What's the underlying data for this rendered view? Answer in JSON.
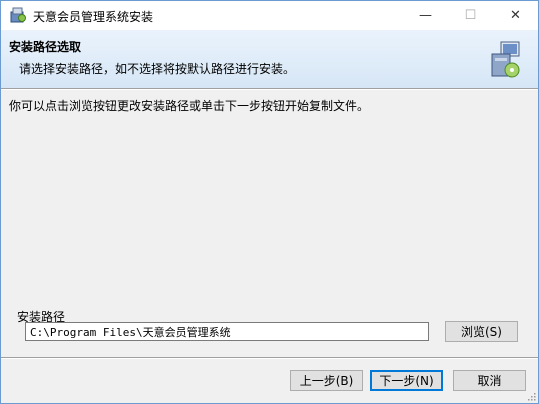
{
  "window": {
    "title": "天意会员管理系统安装",
    "min_glyph": "—",
    "max_glyph": "☐",
    "close_glyph": "✕"
  },
  "header": {
    "title": "安装路径选取",
    "subtitle": "请选择安装路径，如不选择将按默认路径进行安装。"
  },
  "body": {
    "instruction": "你可以点击浏览按钮更改安装路径或单击下一步按钮开始复制文件。"
  },
  "path": {
    "label": "安装路径",
    "value": "C:\\Program Files\\天意会员管理系统",
    "browse_label": "浏览(S)"
  },
  "buttons": {
    "prev": "上一步(B)",
    "next": "下一步(N)",
    "cancel": "取消"
  },
  "colors": {
    "accent": "#0078d7",
    "header_gradient_top": "#eaf3fc",
    "header_gradient_bottom": "#d6e6f6"
  }
}
